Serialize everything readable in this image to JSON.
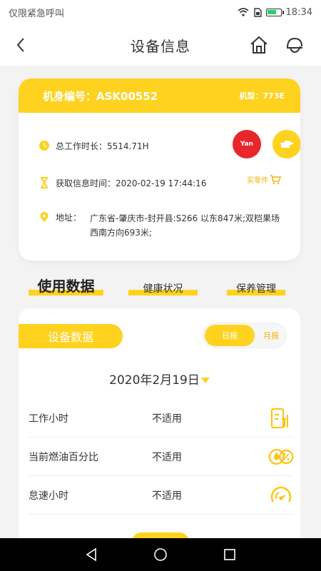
{
  "status_bar": {
    "carrier": "仅限紧急呼叫",
    "time": "18:34"
  },
  "nav": {
    "title": "设备信息",
    "icons": [
      "back-arrow-icon",
      "home-icon",
      "helmet-icon"
    ]
  },
  "info_card": {
    "machine_no": "机身编号：ASK00552",
    "model": "机型：773E",
    "work_hours": "总工作时长：5514.71H",
    "fetch_time": "获取信息时间：2020-02-19 17:44:16",
    "address_label": "地址：",
    "address": "广东省-肇庆市-封开县:S266 以东847米;双桤果场 西南方向693米;",
    "buy_parts": "买零件",
    "badge_red_text": "Yan",
    "colors": {
      "accent": "#ffd21f",
      "red": "#e8262c"
    }
  },
  "tabs": {
    "usage": "使用数据",
    "health": "健康状况",
    "maintenance": "保养管理"
  },
  "data_card": {
    "title": "设备数据",
    "toggle_day": "日报",
    "toggle_month": "月报",
    "date": "2020年2月19日",
    "metrics": [
      {
        "label": "工作小时",
        "value": "不适用",
        "icon": "hours-icon"
      },
      {
        "label": "当前燃油百分比",
        "value": "不适用",
        "icon": "fuel-percent-icon"
      },
      {
        "label": "怠速小时",
        "value": "不适用",
        "icon": "idle-gauge-icon"
      }
    ]
  }
}
